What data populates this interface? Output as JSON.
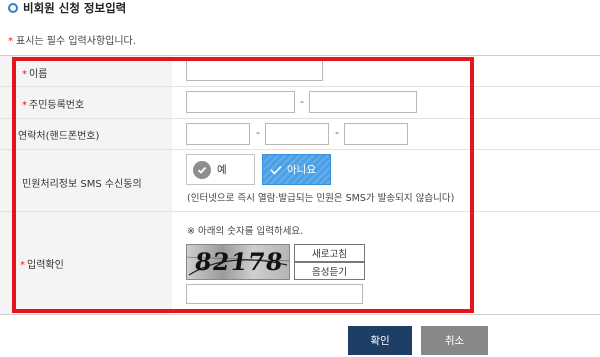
{
  "section_title": "비회원 신청 정보입력",
  "required_note": "표시는 필수 입력사항입니다.",
  "required_mark": "*",
  "fields": {
    "name": {
      "label": "이름",
      "value": ""
    },
    "resident_number": {
      "label": "주민등록번호",
      "part1": "",
      "part2": "",
      "separator": "-"
    },
    "phone": {
      "label": "연락처(핸드폰번호)",
      "part1": "",
      "part2": "",
      "part3": "",
      "separator": "-"
    },
    "sms_consent": {
      "label": "민원처리정보 SMS 수신동의",
      "yes_label": "예",
      "no_label": "아니요",
      "selected": "아니요",
      "note": "(인터넷으로 즉시 열람·발급되는 민원은 SMS가 발송되지 않습니다)"
    },
    "captcha": {
      "label": "입력확인",
      "instruction": "※ 아래의 숫자를 입력하세요.",
      "captcha_text": "82178",
      "refresh_label": "새로고침",
      "audio_label": "음성듣기",
      "value": ""
    }
  },
  "buttons": {
    "confirm": "확인",
    "cancel": "취소"
  },
  "colors": {
    "accent_blue": "#4aa0e6",
    "highlight_red": "#e3161e",
    "confirm_bg": "#1e3e66",
    "cancel_bg": "#888888",
    "required_star": "#dd2222"
  }
}
